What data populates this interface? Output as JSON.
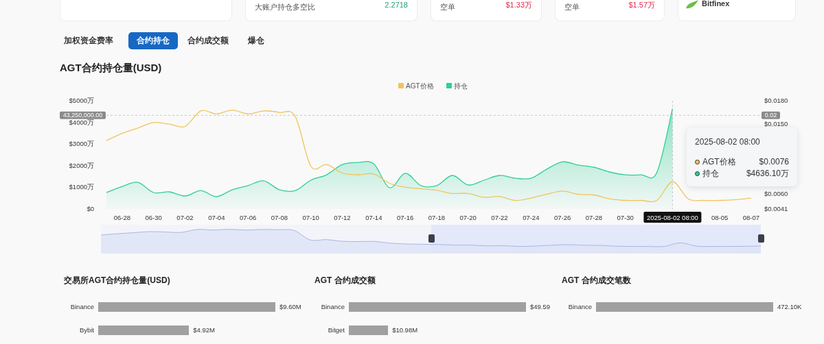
{
  "summary_cards": [
    {
      "kind": "blank"
    },
    {
      "kind": "stat",
      "label": "大账户持仓多空比",
      "value": "2.2718",
      "color": "#1aa37a"
    },
    {
      "kind": "stat",
      "label": "空单",
      "value": "$1.33万",
      "color": "#e0294a"
    },
    {
      "kind": "stat",
      "label": "空单",
      "value": "$1.57万",
      "color": "#e0294a"
    },
    {
      "kind": "logo",
      "label": "Bitfinex"
    }
  ],
  "tabs": [
    {
      "label": "加权资金费率",
      "selected": false
    },
    {
      "label": "合约持仓",
      "selected": true
    },
    {
      "label": "合约成交额",
      "selected": false
    },
    {
      "label": "爆仓",
      "selected": false
    }
  ],
  "chart": {
    "title": "AGT合约持仓量(USD)",
    "chart_data": {
      "type": "area",
      "categories": [
        null,
        "06-28",
        null,
        "06-30",
        null,
        "07-02",
        null,
        "07-04",
        null,
        "07-06",
        null,
        "07-08",
        null,
        "07-10",
        null,
        "07-12",
        null,
        "07-14",
        null,
        "07-16",
        null,
        "07-18",
        null,
        "07-20",
        null,
        "07-22",
        null,
        "07-24",
        null,
        "07-26",
        null,
        "07-28",
        null,
        "07-30",
        null,
        null,
        null,
        null,
        null,
        "08-05",
        null,
        "08-07"
      ],
      "series": [
        {
          "name": "AGT价格",
          "color": "#f0c45c",
          "axis": "y2",
          "type": "line",
          "values": [
            0.0129,
            0.0138,
            0.0145,
            0.0152,
            0.015,
            0.0147,
            0.0167,
            0.0163,
            0.0168,
            0.0163,
            0.0167,
            0.0165,
            0.016,
            0.0096,
            0.0098,
            0.0087,
            0.0085,
            0.0086,
            0.0074,
            0.0069,
            0.0067,
            0.0065,
            0.0061,
            0.0061,
            0.0056,
            0.0057,
            0.0052,
            0.0055,
            0.006,
            0.0064,
            0.006,
            0.0059,
            0.0054,
            0.0052,
            0.0052,
            0.0052,
            0.0076,
            0.0054,
            0.0052,
            0.0052,
            0.0053,
            0.0055
          ]
        },
        {
          "name": "持仓",
          "color": "#2fcf95",
          "values": [
            760,
            1040,
            1230,
            760,
            790,
            600,
            850,
            570,
            890,
            1080,
            1300,
            890,
            850,
            1330,
            1580,
            2050,
            2150,
            2090,
            980,
            1650,
            1080,
            1080,
            1550,
            1110,
            1330,
            1550,
            1420,
            1420,
            1840,
            2180,
            2030,
            1930,
            1710,
            1580,
            1580,
            1680,
            4636,
            null,
            null,
            null,
            null,
            null
          ]
        }
      ],
      "legend": "top",
      "ylim": [
        0,
        5000
      ],
      "yticks": [
        {
          "value": 0,
          "label": "$0"
        },
        {
          "value": 1000,
          "label": "$1000万"
        },
        {
          "value": 2000,
          "label": "$2000万"
        },
        {
          "value": 3000,
          "label": "$3000万"
        },
        {
          "value": 4000,
          "label": "$4000万"
        },
        {
          "value": 5000,
          "label": "$5000万"
        }
      ],
      "y2lim": [
        0.0041,
        0.018
      ],
      "y2ticks": [
        {
          "value": 0.0041,
          "label": "$0.0041"
        },
        {
          "value": 0.006,
          "label": "$0.0060"
        },
        {
          "value": 0.015,
          "label": "$0.0150"
        },
        {
          "value": 0.018,
          "label": "$0.0180"
        }
      ]
    },
    "crosshair": {
      "y_label": "43,250,000.00",
      "y2_label": "0.02",
      "x_label": "2025-08-02 08:00"
    },
    "tooltip": {
      "title": "2025-08-02 08:00",
      "rows": [
        {
          "name": "AGT价格",
          "value": "$0.0076",
          "color": "#f0c45c"
        },
        {
          "name": "持仓",
          "value": "$4636.10万",
          "color": "#2fcf95"
        }
      ]
    }
  },
  "panels": [
    {
      "title": "交易所AGT合约持仓量(USD)",
      "chart_data": {
        "type": "bar",
        "orientation": "horizontal",
        "categories": [
          "Binance",
          "Bybit"
        ],
        "values": [
          9.6,
          4.92
        ],
        "value_labels": [
          "$9.60M",
          "$4.92M"
        ]
      }
    },
    {
      "title": "AGT 合约成交额",
      "chart_data": {
        "type": "bar",
        "orientation": "horizontal",
        "categories": [
          "Binance",
          "Bitget"
        ],
        "values": [
          49.59,
          10.98
        ],
        "value_labels": [
          "$49.59",
          "$10.98M"
        ]
      }
    },
    {
      "title": "AGT 合约成交笔数",
      "chart_data": {
        "type": "bar",
        "orientation": "horizontal",
        "categories": [
          "Binance"
        ],
        "values": [
          472.1
        ],
        "value_labels": [
          "472.10K"
        ]
      }
    }
  ]
}
